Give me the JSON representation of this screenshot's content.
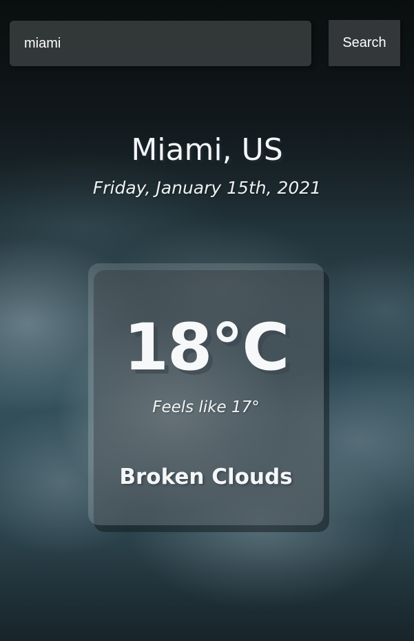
{
  "search": {
    "value": "miami",
    "button_label": "Search"
  },
  "location": {
    "name": "Miami, US",
    "date": "Friday, January 15th, 2021"
  },
  "weather": {
    "temperature": "18°C",
    "feels_like": "Feels like 17°",
    "condition": "Broken Clouds"
  }
}
